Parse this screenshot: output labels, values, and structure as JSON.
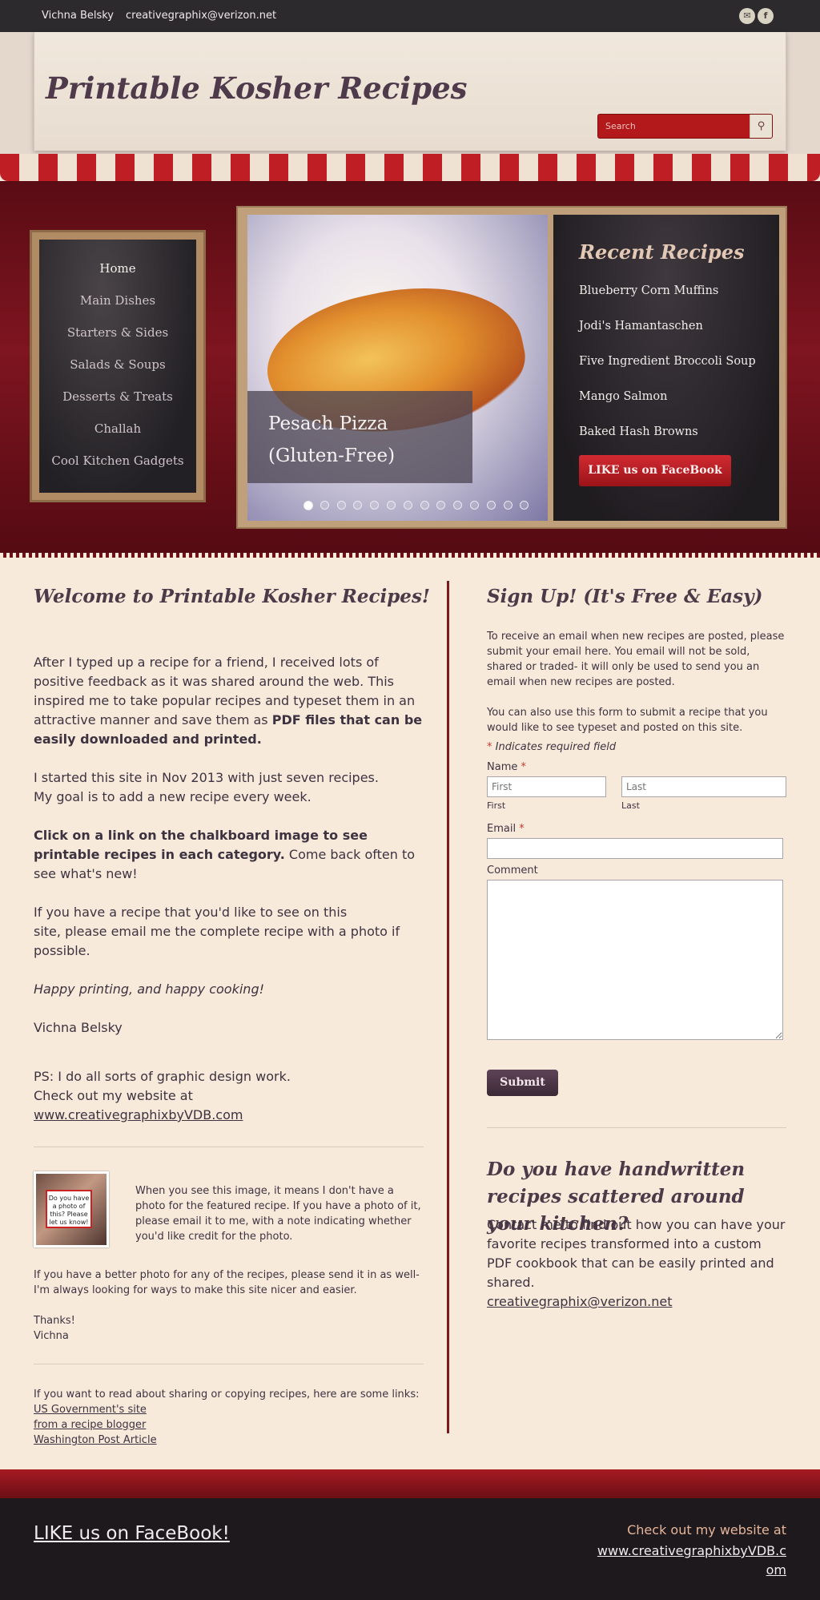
{
  "topbar": {
    "name": "Vichna Belsky",
    "email": "creativegraphix@verizon.net",
    "icons": [
      "email-icon",
      "facebook-icon"
    ],
    "email_glyph": "✉",
    "facebook_glyph": "f"
  },
  "header": {
    "title": "Printable Kosher Recipes",
    "search_placeholder": "Search",
    "search_glyph": "⚲"
  },
  "chalkboard": {
    "items": [
      "Home",
      "Main Dishes",
      "Starters & Sides",
      "Salads & Soups",
      "Desserts & Treats",
      "Challah",
      "Cool Kitchen Gadgets"
    ]
  },
  "slider": {
    "caption_line1": "Pesach Pizza",
    "caption_line2": "(Gluten-Free)",
    "slide_count": 14,
    "active_slide": 1
  },
  "recent": {
    "title": "Recent Recipes",
    "items": [
      "Blueberry Corn Muffins",
      "Jodi's Hamantaschen",
      "Five Ingredient Broccoli Soup",
      "Mango Salmon",
      "Baked Hash Browns"
    ],
    "facebook_button": "LIKE us on FaceBook"
  },
  "welcome": {
    "title": "Welcome to Printable Kosher Recipes!",
    "p1": "After I typed up a recipe for a friend, I received lots of positive feedback as it was shared around the web. This inspired me to take popular recipes and typeset them in an attractive manner and save them as ",
    "p1_bold": "PDF files that can be easily downloaded and printed.",
    "p2a": "I started this site in Nov 2013 with just seven recipes.",
    "p2b": "My goal is to add a new recipe every week.",
    "p3_bold": "Click on a link on the chalkboard image to see printable recipes in each category.",
    "p3": " Come back often to see what's new!",
    "p4a": "If you have a recipe that you'd like to see on this",
    "p4b": "site, please email me the complete recipe with a photo if possible.",
    "p5": "Happy printing, and happy cooking!",
    "p6": "Vichna Belsky",
    "p7a": "PS: I do all sorts of graphic design work.",
    "p7b": "Check out my website at",
    "p7_link": "www.creativegraphixbyVDB.com",
    "thumb_text": "Do you have a photo of this? Please let us know!",
    "photo_note": "When you see this image, it means I don't have a photo for the featured recipe. If you have a photo of it, please email it to me, with a note indicating whether you'd like credit for the photo.",
    "better_photo": "If you have a better photo for any of the recipes, please send it in as well- I'm always looking for ways to make this site nicer and easier.",
    "thanks": "Thanks!",
    "sign": "Vichna",
    "links_intro": "If you want to read about sharing or copying recipes, here are some links:",
    "links": [
      "US Government's site",
      "from a recipe blogger",
      "Washington Post Article"
    ]
  },
  "signup": {
    "title": "Sign Up! (It's Free & Easy)",
    "p1": "To receive an email when new recipes are posted, please submit your email here. You email will not be sold, shared or traded- it will only be used to send you an email when new recipes are posted.",
    "p2": "You can also use this form to submit a recipe that you would like to see typeset and posted on this site.",
    "required_note": "Indicates required field",
    "asterisk": "*",
    "name_label": "Name",
    "first_placeholder": "First",
    "last_placeholder": "Last",
    "first_sub": "First",
    "last_sub": "Last",
    "email_label": "Email",
    "comment_label": "Comment",
    "submit": "Submit"
  },
  "handwritten": {
    "title": "Do you have handwritten recipes scattered around your kitchen?",
    "body": "Contact me to find out how you can have your favorite recipes transformed into a custom PDF cookbook that can be easily printed and shared.",
    "email": "creativegraphix@verizon.net"
  },
  "footer": {
    "facebook": "LIKE us on FaceBook!",
    "website_intro": "Check out my website at",
    "website": "www.creativegraphixbyVDB.com"
  }
}
